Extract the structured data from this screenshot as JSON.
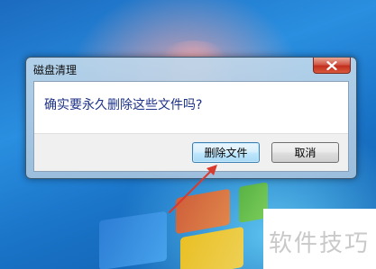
{
  "dialog": {
    "title": "磁盘清理",
    "message": "确实要永久删除这些文件吗?",
    "buttons": {
      "confirm_label": "删除文件",
      "cancel_label": "取消"
    }
  },
  "watermark": {
    "text": "软件技巧"
  },
  "colors": {
    "message_text": "#1e3287",
    "close_button": "#c2301e",
    "annotation_arrow": "#d83a2e"
  }
}
